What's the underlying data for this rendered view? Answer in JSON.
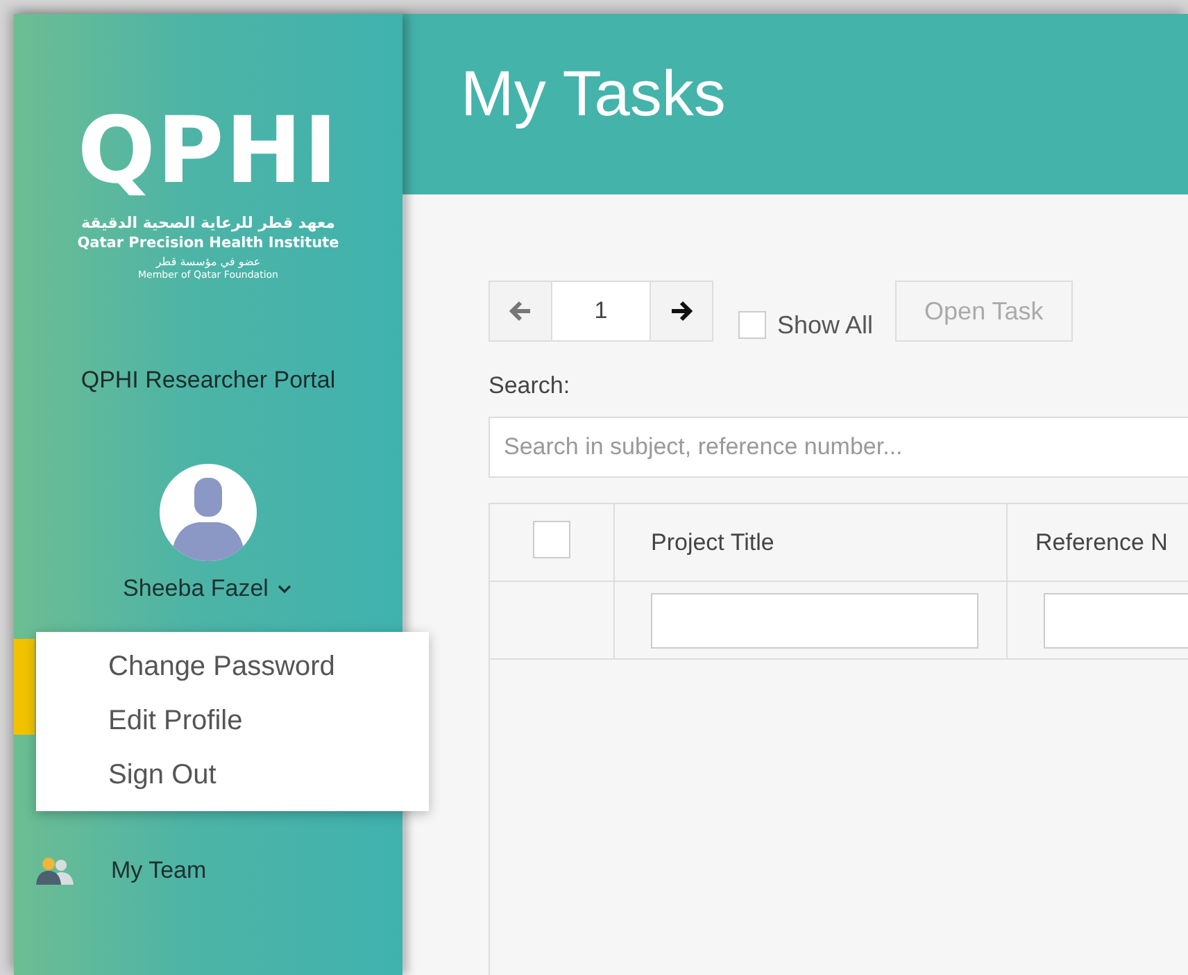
{
  "sidebar": {
    "logo": {
      "mark": "QPHI",
      "arabic_name": "معهد قطر للرعاية الصحية الدقيقة",
      "english_name": "Qatar Precision Health Institute",
      "arabic_tagline": "عضو في مؤسسة قطر",
      "tagline": "Member of Qatar Foundation"
    },
    "portal_title": "QPHI Researcher Portal",
    "user": {
      "name": "Sheeba Fazel",
      "menu_expanded": true,
      "menu": [
        {
          "label": "Change Password"
        },
        {
          "label": "Edit Profile"
        },
        {
          "label": "Sign Out"
        }
      ]
    },
    "nav": [
      {
        "label": "My Team",
        "kind": "team"
      }
    ]
  },
  "header": {
    "title": "My Tasks"
  },
  "toolbar": {
    "page": "1",
    "show_all": {
      "label": "Show All",
      "checked": false
    },
    "open_task": {
      "label": "Open Task",
      "disabled": true
    }
  },
  "search": {
    "label": "Search:",
    "placeholder": "Search in subject, reference number..."
  },
  "table": {
    "select_all_checked": false,
    "columns": [
      "Project Title",
      "Reference N"
    ]
  }
}
